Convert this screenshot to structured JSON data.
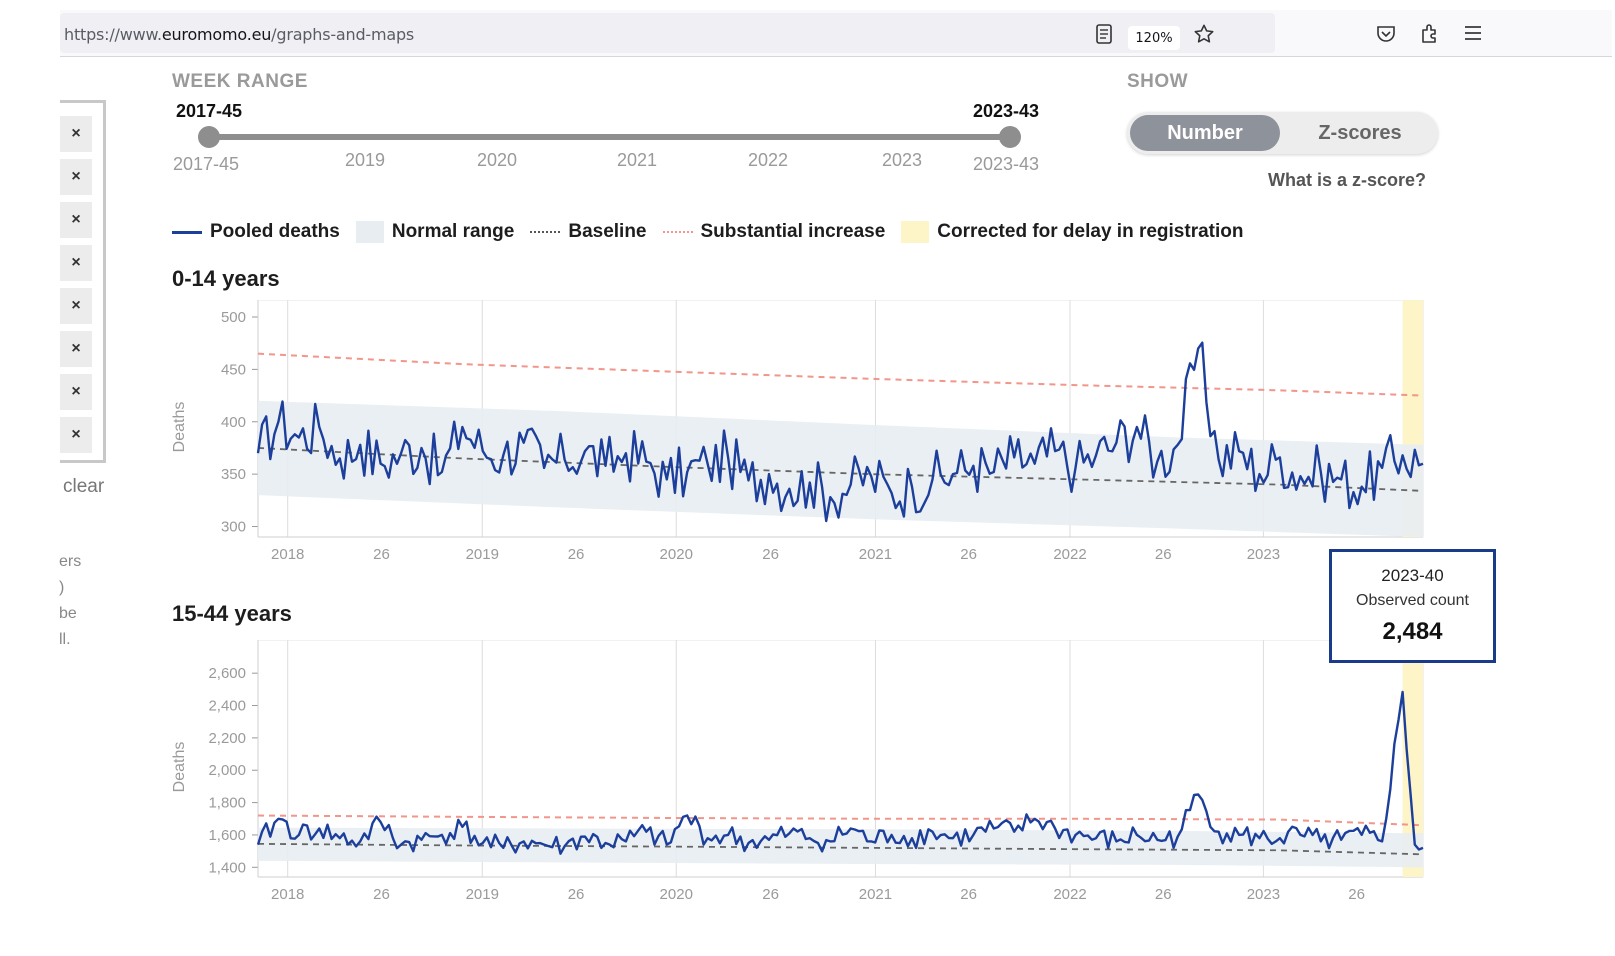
{
  "browser": {
    "url_prefix": "https://www.",
    "url_domain": "euromomo.eu",
    "url_path": "/graphs-and-maps",
    "zoom": "120%"
  },
  "left_panel": {
    "clear_label": "clear",
    "fragments": [
      "ers",
      ")",
      "be",
      "ll."
    ],
    "remove_labels": [
      "×",
      "×",
      "×",
      "×",
      "×",
      "×",
      "×",
      "×"
    ]
  },
  "week_range": {
    "label": "WEEK RANGE",
    "start_value": "2017-45",
    "end_value": "2023-43",
    "min_label": "2017-45",
    "max_label": "2023-43",
    "year_ticks": [
      "2019",
      "2020",
      "2021",
      "2022",
      "2023"
    ]
  },
  "show": {
    "label": "SHOW",
    "options": [
      "Number",
      "Z-scores"
    ],
    "selected": "Number",
    "zscore_link": "What is a z-score?"
  },
  "legend": {
    "items": [
      "Pooled deaths",
      "Normal range",
      "Baseline",
      "Substantial increase",
      "Corrected for delay in registration"
    ]
  },
  "colors": {
    "pooled": "#1c3f9c",
    "normal_range": "#e8edf2",
    "baseline": "#666666",
    "substantial": "#f2958a",
    "delay": "#fdf4c8"
  },
  "tooltip": {
    "week": "2023-40",
    "label": "Observed count",
    "value": "2,484"
  },
  "chart_data": [
    {
      "type": "line",
      "title": "0-14 years",
      "ylabel": "Deaths",
      "ylim": [
        290,
        500
      ],
      "yticks": [
        "300",
        "350",
        "400",
        "450",
        "500"
      ],
      "xticks": [
        "2018",
        "26",
        "2019",
        "26",
        "2020",
        "26",
        "2021",
        "26",
        "2022",
        "26",
        "2023",
        "26"
      ],
      "x_start_week": "2017-45",
      "x_end_week": "2023-43",
      "baseline": [
        [
          0,
          375
        ],
        [
          100,
          365
        ],
        [
          200,
          357
        ],
        [
          300,
          350
        ],
        [
          400,
          345
        ],
        [
          500,
          340
        ],
        [
          570,
          334
        ]
      ],
      "substantial_increase": [
        [
          0,
          465
        ],
        [
          100,
          455
        ],
        [
          200,
          448
        ],
        [
          300,
          441
        ],
        [
          400,
          435
        ],
        [
          500,
          430
        ],
        [
          570,
          425
        ]
      ],
      "normal_range_upper": [
        [
          0,
          420
        ],
        [
          150,
          410
        ],
        [
          300,
          397
        ],
        [
          450,
          385
        ],
        [
          570,
          378
        ]
      ],
      "normal_range_lower": [
        [
          0,
          330
        ],
        [
          150,
          318
        ],
        [
          300,
          307
        ],
        [
          450,
          298
        ],
        [
          570,
          290
        ]
      ],
      "series": [
        {
          "values_sampled": [
            [
              0,
              370
            ],
            [
              10,
              400
            ],
            [
              20,
              385
            ],
            [
              30,
              395
            ],
            [
              40,
              365
            ],
            [
              50,
              378
            ],
            [
              60,
              360
            ],
            [
              70,
              370
            ],
            [
              80,
              375
            ],
            [
              90,
              352
            ],
            [
              100,
              395
            ],
            [
              110,
              372
            ],
            [
              120,
              368
            ],
            [
              130,
              380
            ],
            [
              140,
              356
            ],
            [
              150,
              364
            ],
            [
              160,
              372
            ],
            [
              170,
              358
            ],
            [
              180,
              370
            ],
            [
              190,
              362
            ],
            [
              200,
              345
            ],
            [
              210,
              352
            ],
            [
              220,
              360
            ],
            [
              230,
              366
            ],
            [
              240,
              344
            ],
            [
              250,
              350
            ],
            [
              260,
              336
            ],
            [
              270,
              342
            ],
            [
              280,
              328
            ],
            [
              290,
              340
            ],
            [
              300,
              348
            ],
            [
              310,
              332
            ],
            [
              320,
              338
            ],
            [
              330,
              345
            ],
            [
              340,
              350
            ],
            [
              350,
              358
            ],
            [
              360,
              352
            ],
            [
              370,
              366
            ],
            [
              380,
              360
            ],
            [
              390,
              372
            ],
            [
              400,
              356
            ],
            [
              410,
              368
            ],
            [
              420,
              380
            ],
            [
              430,
              395
            ],
            [
              440,
              362
            ],
            [
              450,
              378
            ],
            [
              460,
              470
            ],
            [
              470,
              364
            ],
            [
              480,
              372
            ],
            [
              490,
              350
            ],
            [
              500,
              366
            ],
            [
              510,
              348
            ],
            [
              520,
              352
            ],
            [
              530,
              345
            ],
            [
              540,
              338
            ],
            [
              550,
              356
            ],
            [
              560,
              368
            ],
            [
              570,
              360
            ]
          ]
        }
      ]
    },
    {
      "type": "line",
      "title": "15-44 years",
      "ylabel": "Deaths",
      "ylim": [
        1340,
        2700
      ],
      "yticks": [
        "1,400",
        "1,600",
        "1,800",
        "2,000",
        "2,200",
        "2,400",
        "2,600"
      ],
      "xticks": [
        "2018",
        "26",
        "2019",
        "26",
        "2020",
        "26",
        "2021",
        "26",
        "2022",
        "26",
        "2023",
        "26"
      ],
      "x_start_week": "2017-45",
      "x_end_week": "2023-43",
      "baseline": [
        [
          0,
          1545
        ],
        [
          100,
          1535
        ],
        [
          200,
          1528
        ],
        [
          300,
          1520
        ],
        [
          400,
          1512
        ],
        [
          500,
          1505
        ],
        [
          570,
          1480
        ]
      ],
      "substantial_increase": [
        [
          0,
          1720
        ],
        [
          100,
          1712
        ],
        [
          200,
          1705
        ],
        [
          300,
          1700
        ],
        [
          400,
          1700
        ],
        [
          500,
          1695
        ],
        [
          570,
          1660
        ]
      ],
      "normal_range_upper": [
        [
          0,
          1645
        ],
        [
          150,
          1640
        ],
        [
          300,
          1635
        ],
        [
          450,
          1625
        ],
        [
          570,
          1610
        ]
      ],
      "normal_range_lower": [
        [
          0,
          1440
        ],
        [
          150,
          1430
        ],
        [
          300,
          1420
        ],
        [
          450,
          1415
        ],
        [
          570,
          1400
        ]
      ],
      "series": [
        {
          "values_sampled": [
            [
              0,
              1540
            ],
            [
              10,
              1700
            ],
            [
              20,
              1600
            ],
            [
              30,
              1640
            ],
            [
              40,
              1580
            ],
            [
              50,
              1560
            ],
            [
              60,
              1680
            ],
            [
              70,
              1540
            ],
            [
              80,
              1570
            ],
            [
              90,
              1600
            ],
            [
              100,
              1650
            ],
            [
              110,
              1550
            ],
            [
              120,
              1520
            ],
            [
              130,
              1560
            ],
            [
              140,
              1540
            ],
            [
              150,
              1530
            ],
            [
              160,
              1590
            ],
            [
              170,
              1550
            ],
            [
              180,
              1560
            ],
            [
              190,
              1620
            ],
            [
              200,
              1540
            ],
            [
              210,
              1720
            ],
            [
              220,
              1580
            ],
            [
              230,
              1600
            ],
            [
              240,
              1550
            ],
            [
              250,
              1570
            ],
            [
              260,
              1610
            ],
            [
              270,
              1580
            ],
            [
              280,
              1560
            ],
            [
              290,
              1640
            ],
            [
              300,
              1560
            ],
            [
              310,
              1600
            ],
            [
              320,
              1580
            ],
            [
              330,
              1620
            ],
            [
              340,
              1580
            ],
            [
              350,
              1600
            ],
            [
              360,
              1640
            ],
            [
              370,
              1620
            ],
            [
              380,
              1700
            ],
            [
              390,
              1640
            ],
            [
              400,
              1600
            ],
            [
              410,
              1580
            ],
            [
              420,
              1560
            ],
            [
              430,
              1600
            ],
            [
              440,
              1570
            ],
            [
              450,
              1590
            ],
            [
              460,
              1850
            ],
            [
              470,
              1620
            ],
            [
              480,
              1600
            ],
            [
              490,
              1580
            ],
            [
              500,
              1580
            ],
            [
              510,
              1600
            ],
            [
              520,
              1560
            ],
            [
              530,
              1570
            ],
            [
              540,
              1600
            ],
            [
              550,
              1560
            ],
            [
              560,
              2484
            ],
            [
              566,
              1540
            ],
            [
              570,
              1520
            ]
          ]
        }
      ]
    }
  ]
}
